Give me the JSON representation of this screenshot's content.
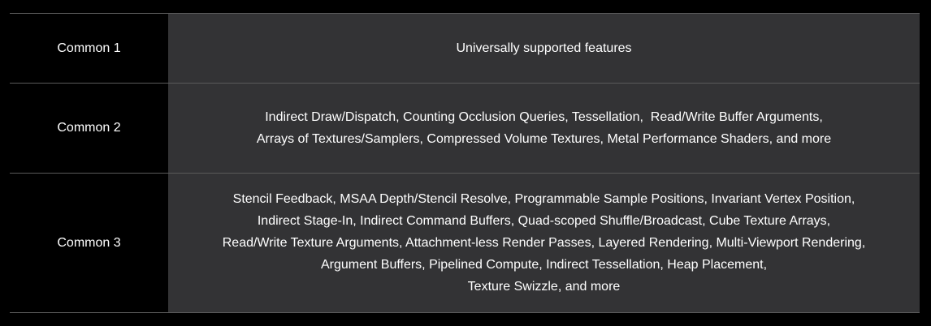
{
  "table": {
    "rows": [
      {
        "label": "Common 1",
        "lines": [
          "Universally supported features"
        ]
      },
      {
        "label": "Common 2",
        "lines": [
          "Indirect Draw/Dispatch, Counting Occlusion Queries, Tessellation,  Read/Write Buffer Arguments,",
          "Arrays of Textures/Samplers, Compressed Volume Textures, Metal Performance Shaders, and more"
        ]
      },
      {
        "label": "Common 3",
        "lines": [
          "Stencil Feedback, MSAA Depth/Stencil Resolve, Programmable Sample Positions, Invariant Vertex Position,",
          "Indirect Stage-In, Indirect Command Buffers, Quad-scoped Shuffle/Broadcast, Cube Texture Arrays,",
          "Read/Write Texture Arguments, Attachment-less Render Passes, Layered Rendering, Multi-Viewport Rendering,",
          "Argument Buffers, Pipelined Compute, Indirect Tessellation, Heap Placement,",
          "Texture Swizzle, and more"
        ]
      }
    ]
  }
}
